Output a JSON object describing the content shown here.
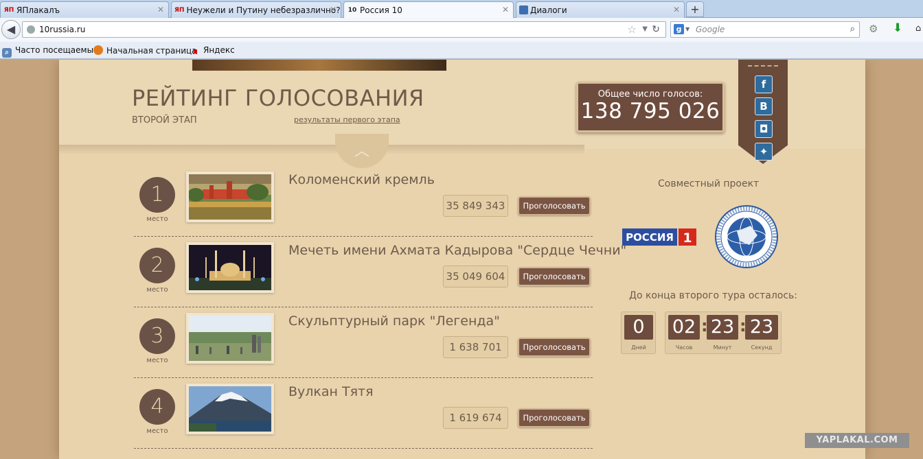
{
  "browser": {
    "tabs": [
      {
        "label": "ЯПлакалъ",
        "favicon": "ЯП",
        "active": false
      },
      {
        "label": "Неужели и Путину небезразлично? ...",
        "favicon": "ЯП",
        "active": false
      },
      {
        "label": "Россия 10",
        "favicon": "10",
        "active": true
      },
      {
        "label": "Диалоги",
        "favicon": "",
        "active": false
      }
    ],
    "new_tab_symbol": "+",
    "url": "10russia.ru",
    "search_placeholder": "Google",
    "bookmarks": [
      {
        "label": "Часто посещаемые"
      },
      {
        "label": "Начальная страница"
      },
      {
        "label": "Яндекс"
      }
    ]
  },
  "header": {
    "title": "РЕЙТИНГ ГОЛОСОВАНИЯ",
    "subtitle": "ВТОРОЙ ЭТАП",
    "first_stage_link": "результаты первого этапа",
    "total_label": "Общее число голосов:",
    "total_value": "138 795 026"
  },
  "social": [
    "facebook-icon",
    "vkontakte-icon",
    "instagram-icon",
    "twitter-icon"
  ],
  "social_glyphs": {
    "facebook": "f",
    "vk": "B",
    "instagram": "◘",
    "twitter": "✦"
  },
  "rank_label": "место",
  "vote_button_label": "Проголосовать",
  "items": [
    {
      "rank": "1",
      "name": "Коломенский кремль",
      "votes": "35 849 343"
    },
    {
      "rank": "2",
      "name": "Мечеть имени Ахмата Кадырова \"Сердце Чечни\"",
      "votes": "35 049 604"
    },
    {
      "rank": "3",
      "name": "Скульптурный парк \"Легенда\"",
      "votes": "1 638 701"
    },
    {
      "rank": "4",
      "name": "Вулкан Тятя",
      "votes": "1 619 674"
    }
  ],
  "sidebar": {
    "partners_label": "Совместный проект",
    "russia1_text": "РОССИЯ",
    "russia1_num": "1",
    "countdown_label": "До конца второго тура осталось:",
    "days": "0",
    "hours": "02",
    "minutes": "23",
    "seconds": "23",
    "days_unit": "Дней",
    "hours_unit": "Часов",
    "minutes_unit": "Минут",
    "seconds_unit": "Секунд"
  },
  "watermark": "YAPLAKAL.COM",
  "colors": {
    "brown": "#6e4c3d",
    "paper": "#e8d3ad",
    "text": "#6e5b4a"
  }
}
